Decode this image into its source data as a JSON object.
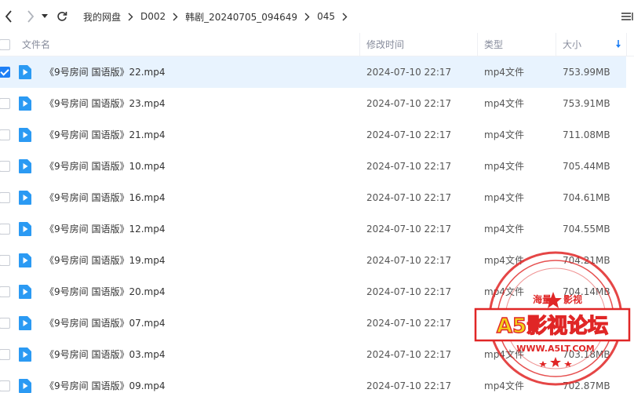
{
  "nav": {
    "breadcrumb": [
      "我的网盘",
      "D002",
      "韩剧_20240705_094649",
      "045"
    ]
  },
  "columns": {
    "name": "文件名",
    "modified": "修改时间",
    "type": "类型",
    "size": "大小"
  },
  "files": [
    {
      "name": "《9号房间 国语版》22.mp4",
      "modified": "2024-07-10 22:17",
      "type": "mp4文件",
      "size": "753.99MB",
      "selected": true
    },
    {
      "name": "《9号房间 国语版》23.mp4",
      "modified": "2024-07-10 22:17",
      "type": "mp4文件",
      "size": "753.91MB",
      "selected": false
    },
    {
      "name": "《9号房间 国语版》21.mp4",
      "modified": "2024-07-10 22:17",
      "type": "mp4文件",
      "size": "711.08MB",
      "selected": false
    },
    {
      "name": "《9号房间 国语版》10.mp4",
      "modified": "2024-07-10 22:17",
      "type": "mp4文件",
      "size": "705.44MB",
      "selected": false
    },
    {
      "name": "《9号房间 国语版》16.mp4",
      "modified": "2024-07-10 22:17",
      "type": "mp4文件",
      "size": "704.61MB",
      "selected": false
    },
    {
      "name": "《9号房间 国语版》12.mp4",
      "modified": "2024-07-10 22:17",
      "type": "mp4文件",
      "size": "704.55MB",
      "selected": false
    },
    {
      "name": "《9号房间 国语版》19.mp4",
      "modified": "2024-07-10 22:17",
      "type": "mp4文件",
      "size": "704.21MB",
      "selected": false
    },
    {
      "name": "《9号房间 国语版》20.mp4",
      "modified": "2024-07-10 22:17",
      "type": "mp4文件",
      "size": "704.14MB",
      "selected": false
    },
    {
      "name": "《9号房间 国语版》07.mp4",
      "modified": "2024-07-10 22:17",
      "type": "mp4文件",
      "size": "703.74MB",
      "selected": false
    },
    {
      "name": "《9号房间 国语版》03.mp4",
      "modified": "2024-07-10 22:17",
      "type": "mp4文件",
      "size": "703.18MB",
      "selected": false
    },
    {
      "name": "《9号房间 国语版》09.mp4",
      "modified": "2024-07-10 22:17",
      "type": "mp4文件",
      "size": "702.87MB",
      "selected": false
    }
  ],
  "watermark": {
    "top_text": "海量",
    "top_text_right": "影视",
    "main_text": "A5影视论坛",
    "url_text": "WWW.A5LT.COM"
  },
  "icons": {
    "back": "chevron-left-icon",
    "forward": "chevron-right-icon",
    "history": "caret-down-icon",
    "refresh": "refresh-icon",
    "sort": "sort-down-arrow-icon",
    "file": "video-file-icon",
    "view": "list-view-icon"
  },
  "colors": {
    "accent": "#1e7ff5",
    "selected_row": "#e8f3fe",
    "file_icon": "#2b9af3",
    "stamp_red": "#e02626",
    "stamp_yellow": "#f3d21a"
  }
}
